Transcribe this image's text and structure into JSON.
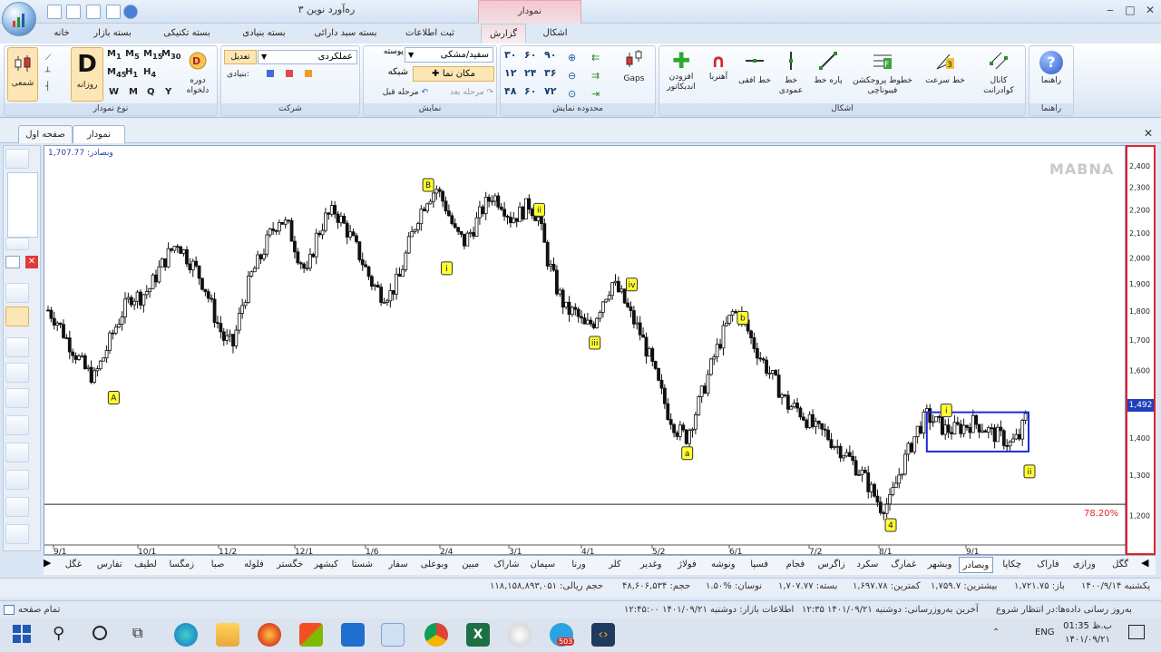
{
  "window": {
    "title": "ره‌آورد نوین ۳",
    "context_tab": "نمودار"
  },
  "ribbon_tabs": [
    "خانه",
    "بسته بازار",
    "بسته تکنیکی",
    "بسته بنیادی",
    "بسته سبد دارائی",
    "ثبت اطلاعات",
    "گزارش",
    "اشکال"
  ],
  "groups": {
    "chart_type": {
      "label": "نوع نمودار",
      "candle": "شمعی",
      "daily": "روزانه",
      "daily_letter": "D",
      "custom_period": "دوره دلخواه",
      "intervals": [
        "1",
        "5",
        "15",
        "30",
        "45",
        "1",
        "4"
      ],
      "period_letters": [
        "W",
        "M",
        "Q",
        "Y"
      ]
    },
    "company": {
      "label": "شرکت",
      "adjust": "تعدیل",
      "dropdown_value": "عملکردی",
      "fundamental": "بنیادی:"
    },
    "display": {
      "label": "نمایش",
      "skin_label": "پوسته",
      "skin_value": "سفید/مشکی",
      "grid": "شبکه",
      "cursor": "مکان نما",
      "prev_step": "مرحله قبل",
      "next_step": "مرحله بعد"
    },
    "range": {
      "label": "محدوده نمایش",
      "values": [
        "۳۰",
        "۶۰",
        "۹۰",
        "۱۲",
        "۲۴",
        "۳۶",
        "۴۸",
        "۶۰",
        "۷۲"
      ],
      "gaps": "Gaps"
    },
    "shapes": {
      "label": "اشکال",
      "add_indicator": "افزودن اندیکاتور",
      "magnet": "آهنربا",
      "horizontal_line": "خط افقی",
      "vertical_line": "خط عمودی",
      "segment": "پاره خط",
      "fibonacci": "خطوط پروجکشن فیبوناچی",
      "speed_line": "خط سرعت",
      "quadrant": "کانال کوادرانت"
    },
    "help": {
      "label": "راهنما",
      "btn": "راهنما"
    }
  },
  "doc_tabs": [
    "نمودار",
    "صفحه اول"
  ],
  "chart": {
    "symbol_readout": "وبصادر: 1,707.77",
    "watermark": "MABNA",
    "fib_label": "78.20%",
    "current_price": "1,492"
  },
  "chart_data": {
    "type": "candlestick",
    "x_ticks": [
      "9/1",
      "10/1",
      "11/2",
      "12/1",
      "1/6",
      "2/4",
      "3/1",
      "4/1",
      "5/2",
      "6/1",
      "7/2",
      "8/1",
      "9/1"
    ],
    "y_ticks": [
      "2,400",
      "2,300",
      "2,200",
      "2,100",
      "2,000",
      "1,900",
      "1,800",
      "1,700",
      "1,600",
      "1,500",
      "1,400",
      "1,300",
      "1,200"
    ],
    "ylim": [
      1130,
      2430
    ],
    "y_log": true,
    "wave_labels": [
      "A",
      "B",
      "i",
      "ii",
      "iii",
      "iv",
      "a",
      "b",
      "4",
      "i",
      "ii"
    ],
    "close_path": [
      1800,
      1760,
      1700,
      1650,
      1600,
      1575,
      1640,
      1720,
      1790,
      1850,
      1850,
      1880,
      1950,
      2010,
      2060,
      2000,
      1950,
      1880,
      1780,
      1700,
      1680,
      1820,
      1930,
      2000,
      2090,
      2160,
      2120,
      2010,
      1930,
      2080,
      2160,
      2190,
      2130,
      2060,
      1980,
      1900,
      1860,
      1860,
      1920,
      2050,
      2170,
      2250,
      2290,
      2210,
      2100,
      2060,
      2120,
      2200,
      2260,
      2230,
      2160,
      2180,
      2220,
      2160,
      1990,
      1880,
      1800,
      1790,
      1740,
      1760,
      1840,
      1900,
      1850,
      1780,
      1720,
      1640,
      1550,
      1470,
      1420,
      1400,
      1470,
      1550,
      1640,
      1720,
      1790,
      1780,
      1700,
      1640,
      1590,
      1540,
      1490,
      1480,
      1450,
      1420,
      1410,
      1380,
      1360,
      1330,
      1300,
      1260,
      1220,
      1230,
      1300,
      1360,
      1420,
      1460,
      1440,
      1420,
      1420,
      1430,
      1440,
      1430,
      1410,
      1400,
      1380,
      1400,
      1480
    ],
    "fib_level": 1225,
    "box": {
      "from_index": 95,
      "to_index": 106,
      "low": 1360,
      "high": 1470
    }
  },
  "symbols": [
    "گگل",
    "ورازی",
    "فاراک",
    "چکاپا",
    "وبصادر",
    "وبشهر",
    "غمارگ",
    "سکرد",
    "زاگرس",
    "فجام",
    "فسپا",
    "ونوشه",
    "فولاژ",
    "وغدیر",
    "کلر",
    "ورنا",
    "سیمان",
    "شاراک",
    "مبین",
    "وبوعلی",
    "سفار",
    "شستا",
    "کبشهر",
    "خگستر",
    "فلوله",
    "صبا",
    "زمگسا",
    "لطیف",
    "تفارس",
    "غگل"
  ],
  "active_symbol": "وبصادر",
  "info_bar": {
    "date": "یکشنبه ۱۴۰۰/۹/۱۴",
    "open": "باز: ۱,۷۲۱.۷۵",
    "high": "بیشترین: ۱,۷۵۹.۷",
    "low": "کمترین: ۱,۶۹۷.۷۸",
    "close": "بسته: ۱,۷۰۷.۷۷",
    "change": "نوسان: %۱.۵۰",
    "volume": "حجم: ۴۸,۶۰۶,۵۳۴",
    "value": "حجم ریالی: ۱۱۸,۱۵۸,۸۹۳,۰۵۱"
  },
  "status": {
    "update_status": "به‌روز رسانی داده‌ها:در انتظار شروع",
    "last_update": "آخرین به‌روزرسانی: دوشنبه ۱۴۰۱/۰۹/۲۱ ۱۲:۳۵",
    "market_info": "اطلاعات بازار: دوشنبه ۱۴۰۱/۰۹/۲۱ ۱۲:۴۵:۰۰",
    "page": "تمام صفحه"
  },
  "taskbar": {
    "lang": "ENG",
    "time": "01:35 ب.ظ",
    "date": "۱۴۰۱/۰۹/۲۱",
    "badge": "503"
  },
  "colors": {
    "accent": "#2e6fb5",
    "fib_red": "#e0242a",
    "wave_label_bg": "#ffff33",
    "box_stroke": "#1f2bd6"
  }
}
